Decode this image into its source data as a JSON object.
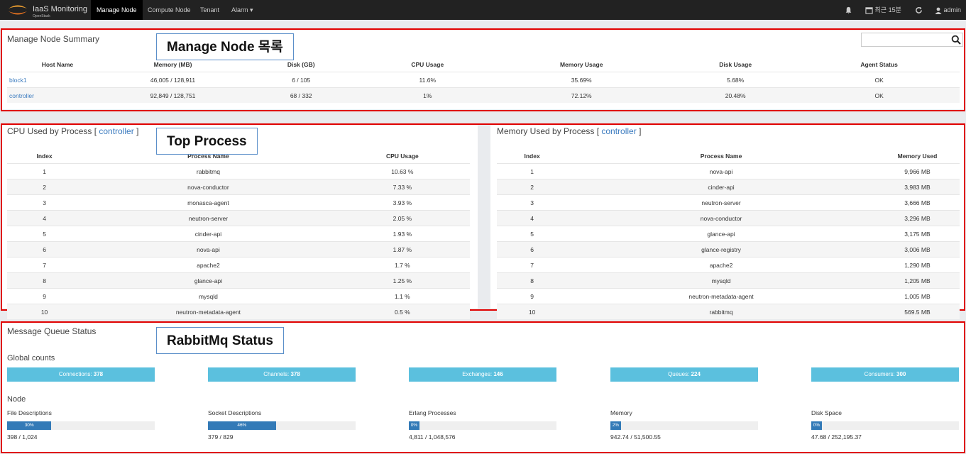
{
  "brand": {
    "title": "IaaS Monitoring",
    "subtitle": "OpenStack",
    "logo": "openstack-logo-icon"
  },
  "nav": {
    "items": [
      {
        "label": "Manage Node",
        "active": true
      },
      {
        "label": "Compute Node",
        "active": false
      },
      {
        "label": "Tenant",
        "active": false
      },
      {
        "label": "Alarm",
        "active": false
      }
    ],
    "alarm_caret": "▾",
    "time_range": "최근 15분",
    "user": "admin"
  },
  "summary": {
    "title": "Manage Node Summary",
    "annotation": "Manage Node 목록",
    "search_placeholder": "",
    "columns": [
      "Host Name",
      "Memory (MB)",
      "Disk (GB)",
      "CPU Usage",
      "Memory Usage",
      "Disk Usage",
      "Agent Status"
    ],
    "rows": [
      [
        "block1",
        "46,005 / 128,911",
        "6 / 105",
        "11.6%",
        "35.69%",
        "5.68%",
        "OK"
      ],
      [
        "controller",
        "92,849 / 128,751",
        "68 / 332",
        "1%",
        "72.12%",
        "20.48%",
        "OK"
      ]
    ]
  },
  "cpu_process": {
    "title_prefix": "CPU Used by Process [ ",
    "host": "controller",
    "title_suffix": " ]",
    "annotation": "Top Process",
    "columns": [
      "Index",
      "Process Name",
      "CPU Usage"
    ],
    "rows": [
      [
        "1",
        "rabbitmq",
        "10.63 %"
      ],
      [
        "2",
        "nova-conductor",
        "7.33 %"
      ],
      [
        "3",
        "monasca-agent",
        "3.93 %"
      ],
      [
        "4",
        "neutron-server",
        "2.05 %"
      ],
      [
        "5",
        "cinder-api",
        "1.93 %"
      ],
      [
        "6",
        "nova-api",
        "1.87 %"
      ],
      [
        "7",
        "apache2",
        "1.7 %"
      ],
      [
        "8",
        "glance-api",
        "1.25 %"
      ],
      [
        "9",
        "mysqld",
        "1.1 %"
      ],
      [
        "10",
        "neutron-metadata-agent",
        "0.5 %"
      ]
    ]
  },
  "mem_process": {
    "title_prefix": "Memory Used by Process [ ",
    "host": "controller",
    "title_suffix": " ]",
    "columns": [
      "Index",
      "Process Name",
      "Memory Used"
    ],
    "rows": [
      [
        "1",
        "nova-api",
        "9,966 MB"
      ],
      [
        "2",
        "cinder-api",
        "3,983 MB"
      ],
      [
        "3",
        "neutron-server",
        "3,666 MB"
      ],
      [
        "4",
        "nova-conductor",
        "3,296 MB"
      ],
      [
        "5",
        "glance-api",
        "3,175 MB"
      ],
      [
        "6",
        "glance-registry",
        "3,006 MB"
      ],
      [
        "7",
        "apache2",
        "1,290 MB"
      ],
      [
        "8",
        "mysqld",
        "1,205 MB"
      ],
      [
        "9",
        "neutron-metadata-agent",
        "1,005 MB"
      ],
      [
        "10",
        "rabbitmq",
        "569.5 MB"
      ]
    ]
  },
  "mq": {
    "title": "Message Queue Status",
    "annotation": "RabbitMq Status",
    "global_label": "Global counts",
    "counts": [
      {
        "label": "Connections: ",
        "value": "378"
      },
      {
        "label": "Channels: ",
        "value": "378"
      },
      {
        "label": "Exchanges: ",
        "value": "146"
      },
      {
        "label": "Queues: ",
        "value": "224"
      },
      {
        "label": "Consumers: ",
        "value": "300"
      }
    ],
    "node_label": "Node",
    "metrics": [
      {
        "label": "File Descriptions",
        "percent": 30,
        "percent_text": "30%",
        "detail": "398 / 1,024"
      },
      {
        "label": "Socket Descriptions",
        "percent": 46,
        "percent_text": "46%",
        "detail": "379 / 829"
      },
      {
        "label": "Erlang Processes",
        "percent": 0,
        "percent_text": "0%",
        "detail": "4,811 / 1,048,576"
      },
      {
        "label": "Memory",
        "percent": 2,
        "percent_text": "2%",
        "detail": "942.74 / 51,500.55"
      },
      {
        "label": "Disk Space",
        "percent": 0,
        "percent_text": "0%",
        "detail": "47.68 / 252,195.37"
      }
    ]
  },
  "colors": {
    "accent": "#337ab7",
    "info": "#5bc0de",
    "annotation_border": "#e00000",
    "link": "#3b7bbf"
  }
}
